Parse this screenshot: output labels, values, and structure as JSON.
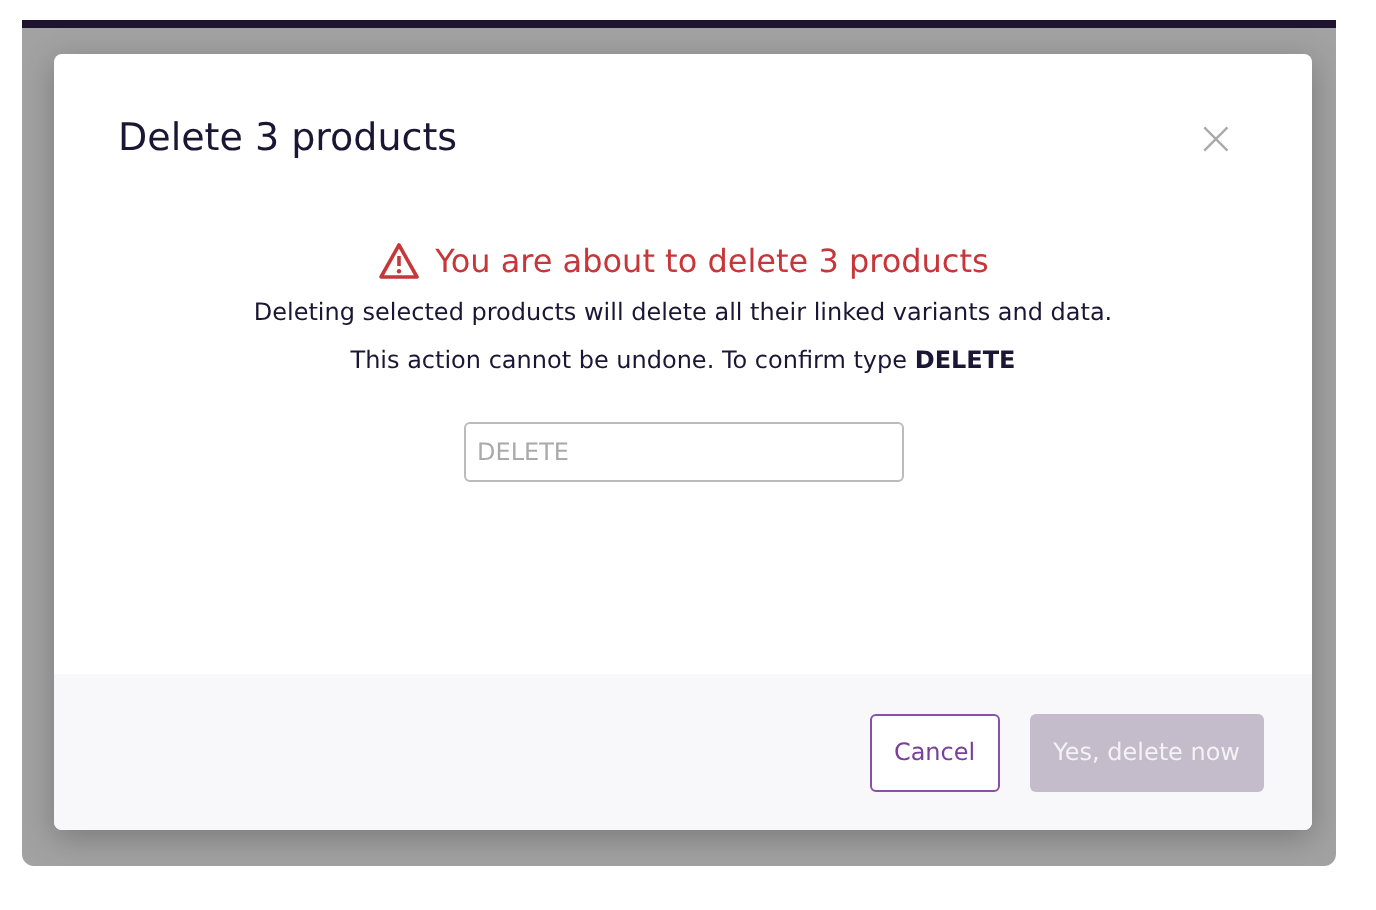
{
  "dialog": {
    "title": "Delete 3 products",
    "close": "×",
    "warning": {
      "heading": "You are about to delete 3 products",
      "lines": [
        "Deleting selected products will delete all their linked variants and data.",
        "This action cannot be undone. To confirm type **DELETE**"
      ]
    },
    "confirm_field": {
      "placeholder": "DELETE"
    },
    "buttons": [
      {
        "label": "Cancel",
        "kind": "secondary",
        "disabled": false
      },
      {
        "label": "Yes, delete now",
        "kind": "primary",
        "disabled": true
      }
    ]
  }
}
